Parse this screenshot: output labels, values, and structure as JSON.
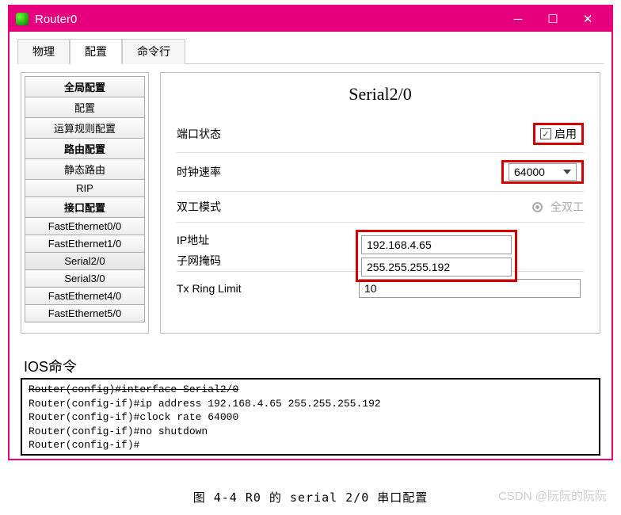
{
  "window": {
    "title": "Router0"
  },
  "tabs": [
    "物理",
    "配置",
    "命令行"
  ],
  "active_tab": 1,
  "sidebar": {
    "groups": [
      {
        "header": "全局配置",
        "items": [
          "配置",
          "运算规则配置"
        ]
      },
      {
        "header": "路由配置",
        "items": [
          "静态路由",
          "RIP"
        ]
      },
      {
        "header": "接口配置",
        "items": [
          "FastEthernet0/0",
          "FastEthernet1/0",
          "Serial2/0",
          "Serial3/0",
          "FastEthernet4/0",
          "FastEthernet5/0"
        ]
      }
    ],
    "selected": "Serial2/0"
  },
  "panel": {
    "title": "Serial2/0",
    "port_state_label": "端口状态",
    "port_state_enable": "启用",
    "port_state_checked": true,
    "clock_label": "时钟速率",
    "clock_value": "64000",
    "duplex_label": "双工模式",
    "duplex_value": "全双工",
    "ip_label": "IP地址",
    "ip_value": "192.168.4.65",
    "mask_label": "子网掩码",
    "mask_value": "255.255.255.192",
    "txring_label": "Tx Ring Limit",
    "txring_value": "10"
  },
  "ios": {
    "label": "IOS命令",
    "lines": [
      "Router(config)#interface Serial2/0",
      "Router(config-if)#ip address 192.168.4.65 255.255.255.192",
      "Router(config-if)#clock rate 64000",
      "Router(config-if)#no shutdown",
      "Router(config-if)#"
    ]
  },
  "caption": "图 4-4 R0 的 serial 2/0 串口配置",
  "watermark": "CSDN @阮阮的阮阮"
}
